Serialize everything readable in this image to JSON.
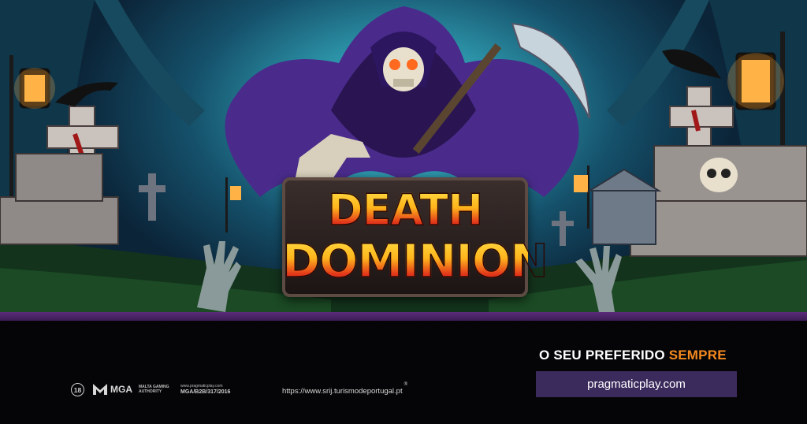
{
  "game": {
    "title_line1": "DEATH",
    "title_line2": "DOMINION"
  },
  "footer": {
    "tagline_main": "O SEU PREFERIDO ",
    "tagline_accent": "SEMPRE",
    "website": "pragmaticplay.com",
    "age_rating": "18",
    "regulator_abbr": "MGA",
    "regulator_name_line1": "MALTA GAMING",
    "regulator_name_line2": "AUTHORITY",
    "regulator_site": "www.pragmaticplay.com",
    "license_number": "MGA/B2B/317/2016",
    "srij_url": "https://www.srij.turismodeportugal.pt",
    "srij_mark": "®"
  },
  "colors": {
    "accent_orange": "#f58a1f",
    "purple_bar": "#3b2a5c",
    "divider": "#5a2c7a",
    "footer_bg": "#050507"
  }
}
